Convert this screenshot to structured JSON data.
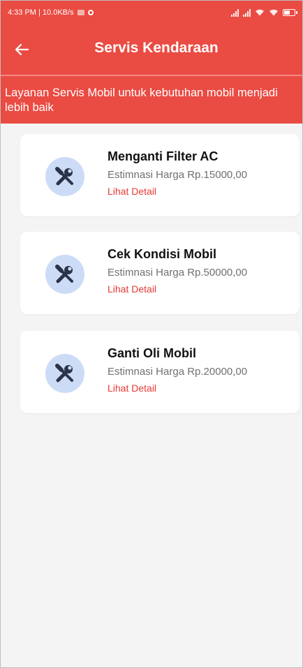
{
  "status_bar": {
    "time_speed": "4:33 PM | 10.0KB/s",
    "battery_level": 0.6
  },
  "app_bar": {
    "title": "Servis Kendaraan",
    "back_icon": "arrow-left-icon"
  },
  "banner": {
    "text": "Layanan Servis Mobil untuk kebutuhan mobil menjadi lebih baik"
  },
  "services": [
    {
      "title": "Menganti Filter AC",
      "price": "Estimnasi Harga Rp.15000,00",
      "link": "Lihat Detail",
      "icon": "tools-icon"
    },
    {
      "title": "Cek Kondisi Mobil",
      "price": "Estimnasi Harga Rp.50000,00",
      "link": "Lihat Detail",
      "icon": "tools-icon"
    },
    {
      "title": "Ganti Oli Mobil",
      "price": "Estimnasi Harga Rp.20000,00",
      "link": "Lihat Detail",
      "icon": "tools-icon"
    }
  ],
  "colors": {
    "primary": "#ea4b43",
    "link": "#e53935",
    "icon_bg": "#cddcf6",
    "icon_fg": "#2b3348",
    "background": "#f4f4f4"
  }
}
